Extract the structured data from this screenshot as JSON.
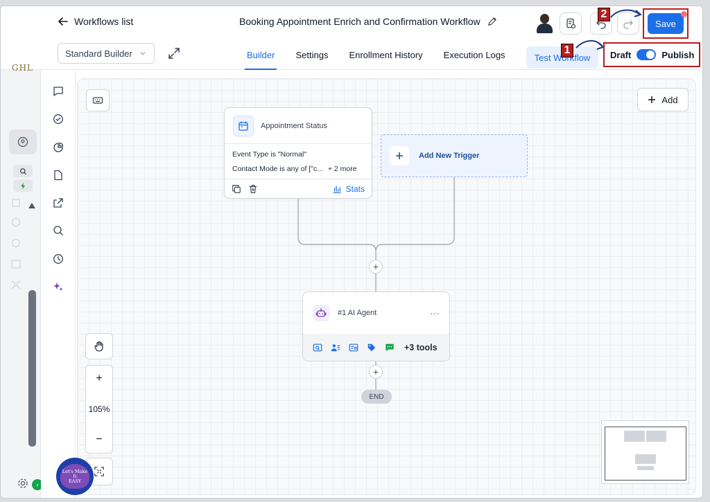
{
  "header": {
    "back_label": "Workflows list",
    "workflow_title": "Booking Appointment Enrich and Confirmation Workflow",
    "save_label": "Save",
    "annotation_1": "1",
    "annotation_2": "2"
  },
  "subheader": {
    "builder_select": "Standard Builder",
    "tabs": [
      {
        "label": "Builder",
        "active": true
      },
      {
        "label": "Settings",
        "active": false
      },
      {
        "label": "Enrollment History",
        "active": false
      },
      {
        "label": "Execution Logs",
        "active": false
      }
    ],
    "test_workflow": "Test Workflow",
    "draft_label": "Draft",
    "publish_label": "Publish",
    "published": true
  },
  "sidebar": {
    "brand": "GHL"
  },
  "canvas": {
    "add_label": "Add",
    "trigger": {
      "title": "Appointment Status",
      "filter_1": "Event Type is \"Normal\"",
      "filter_2": "Contact Mode is any of [\"c...",
      "filter_2_more": "+ 2 more",
      "stats_label": "Stats"
    },
    "new_trigger_label": "Add New Trigger",
    "agent": {
      "title": "#1 AI Agent",
      "more_tools": "+3 tools"
    },
    "end_label": "END",
    "zoom_level": "105%"
  },
  "watermark": {
    "text": "Let's Make It EASY"
  },
  "colors": {
    "accent": "#1d6ee9",
    "annotation": "#b91c1c",
    "agent": "#7e3fbf"
  }
}
